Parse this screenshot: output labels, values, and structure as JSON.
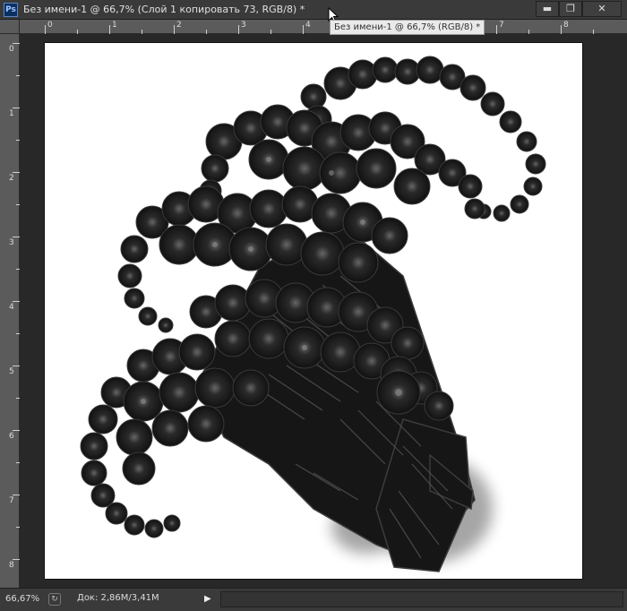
{
  "app": {
    "logo": "Ps"
  },
  "window": {
    "title": "Без имени-1 @ 66,7% (Слой 1 копировать 73, RGB/8) *",
    "buttons": {
      "minimize": "▬",
      "maximize": "❐",
      "close": "✕"
    }
  },
  "tooltip": {
    "text": "Без имени-1 @ 66,7% (RGB/8) *"
  },
  "ruler": {
    "top_marks": [
      "0",
      "1",
      "2",
      "3",
      "4",
      "5",
      "6",
      "7",
      "8"
    ],
    "left_marks": [
      "0",
      "1",
      "2",
      "3",
      "4",
      "5",
      "6",
      "7",
      "8"
    ]
  },
  "status": {
    "zoom": "66,67%",
    "doc_info": "Док: 2,86M/3,41M",
    "arrow": "▶"
  },
  "colors": {
    "canvas": "#ffffff",
    "workspace": "#282828",
    "fractal": "#1a1a1a"
  }
}
